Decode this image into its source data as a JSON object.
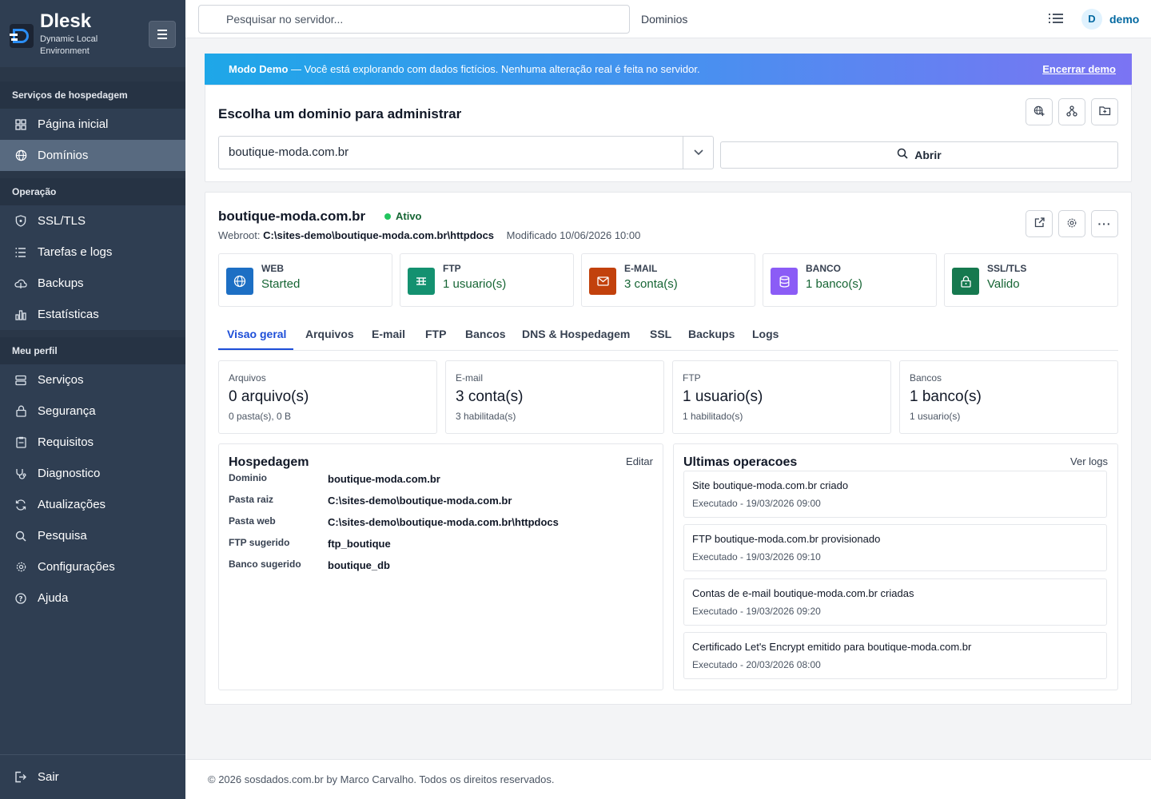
{
  "brand": {
    "title": "Dlesk",
    "subtitle": "Dynamic Local Environment"
  },
  "sidebar": {
    "sections": [
      {
        "title": "Serviços de hospedagem",
        "items": [
          {
            "label": "Página inicial",
            "icon": "dashboard-icon"
          },
          {
            "label": "Domínios",
            "icon": "globe-icon",
            "active": true
          }
        ]
      },
      {
        "title": "Operação",
        "items": [
          {
            "label": "SSL/TLS",
            "icon": "shield-icon"
          },
          {
            "label": "Tarefas e logs",
            "icon": "list-icon"
          },
          {
            "label": "Backups",
            "icon": "cloud-icon"
          },
          {
            "label": "Estatísticas",
            "icon": "chart-icon"
          }
        ]
      },
      {
        "title": "Meu perfil",
        "items": [
          {
            "label": "Serviços",
            "icon": "server-icon"
          },
          {
            "label": "Segurança",
            "icon": "lock-icon"
          },
          {
            "label": "Requisitos",
            "icon": "clipboard-icon"
          },
          {
            "label": "Diagnostico",
            "icon": "stethoscope-icon"
          },
          {
            "label": "Atualizações",
            "icon": "refresh-icon"
          },
          {
            "label": "Pesquisa",
            "icon": "search-icon"
          },
          {
            "label": "Configurações",
            "icon": "gear-icon"
          },
          {
            "label": "Ajuda",
            "icon": "help-icon"
          }
        ]
      }
    ],
    "logout": "Sair"
  },
  "topbar": {
    "search_placeholder": "Pesquisar no servidor...",
    "title": "Dominios",
    "avatar_initial": "D",
    "user": "demo"
  },
  "banner": {
    "strong": "Modo Demo",
    "text": " — Você está explorando com dados fictícios. Nenhuma alteração real é feita no servidor.",
    "end_label": "Encerrar demo"
  },
  "chooser": {
    "title": "Escolha um dominio para administrar",
    "selected": "boutique-moda.com.br",
    "open_label": "Abrir"
  },
  "domain": {
    "name": "boutique-moda.com.br",
    "status": "Ativo",
    "webroot_label": "Webroot:",
    "webroot": "C:\\sites-demo\\boutique-moda.com.br\\httpdocs",
    "modified": "Modificado 10/06/2026 10:00"
  },
  "services": [
    {
      "label": "WEB",
      "value": "Started",
      "color": "#1d6fc4",
      "icon": "globe-icon"
    },
    {
      "label": "FTP",
      "value": "1 usuario(s)",
      "color": "#149170",
      "icon": "ftp-icon"
    },
    {
      "label": "E-MAIL",
      "value": "3 conta(s)",
      "color": "#c2410c",
      "icon": "mail-icon"
    },
    {
      "label": "BANCO",
      "value": "1 banco(s)",
      "color": "#8b5cf6",
      "icon": "database-icon"
    },
    {
      "label": "SSL/TLS",
      "value": "Valido",
      "color": "#16794f",
      "icon": "lock-icon"
    }
  ],
  "tabs": [
    "Visao geral",
    "Arquivos",
    "E-mail",
    "FTP",
    "Bancos",
    "DNS & Hospedagem",
    "SSL",
    "Backups",
    "Logs"
  ],
  "stats": [
    {
      "label": "Arquivos",
      "value": "0 arquivo(s)",
      "sub": "0 pasta(s), 0 B"
    },
    {
      "label": "E-mail",
      "value": "3 conta(s)",
      "sub": "3 habilitada(s)"
    },
    {
      "label": "FTP",
      "value": "1 usuario(s)",
      "sub": "1 habilitado(s)"
    },
    {
      "label": "Bancos",
      "value": "1 banco(s)",
      "sub": "1 usuario(s)"
    }
  ],
  "hosting": {
    "title": "Hospedagem",
    "edit_label": "Editar",
    "rows": [
      {
        "k": "Dominio",
        "v": "boutique-moda.com.br"
      },
      {
        "k": "Pasta raiz",
        "v": "C:\\sites-demo\\boutique-moda.com.br"
      },
      {
        "k": "Pasta web",
        "v": "C:\\sites-demo\\boutique-moda.com.br\\httpdocs"
      },
      {
        "k": "FTP sugerido",
        "v": "ftp_boutique"
      },
      {
        "k": "Banco sugerido",
        "v": "boutique_db"
      }
    ]
  },
  "operations": {
    "title": "Ultimas operacoes",
    "logs_label": "Ver logs",
    "items": [
      {
        "title": "Site boutique-moda.com.br criado",
        "sub": "Executado - 19/03/2026 09:00"
      },
      {
        "title": "FTP boutique-moda.com.br provisionado",
        "sub": "Executado - 19/03/2026 09:10"
      },
      {
        "title": "Contas de e-mail boutique-moda.com.br criadas",
        "sub": "Executado - 19/03/2026 09:20"
      },
      {
        "title": "Certificado Let's Encrypt emitido para boutique-moda.com.br",
        "sub": "Executado - 20/03/2026 08:00"
      }
    ]
  },
  "footer": "© 2026 sosdados.com.br by Marco Carvalho. Todos os direitos reservados."
}
